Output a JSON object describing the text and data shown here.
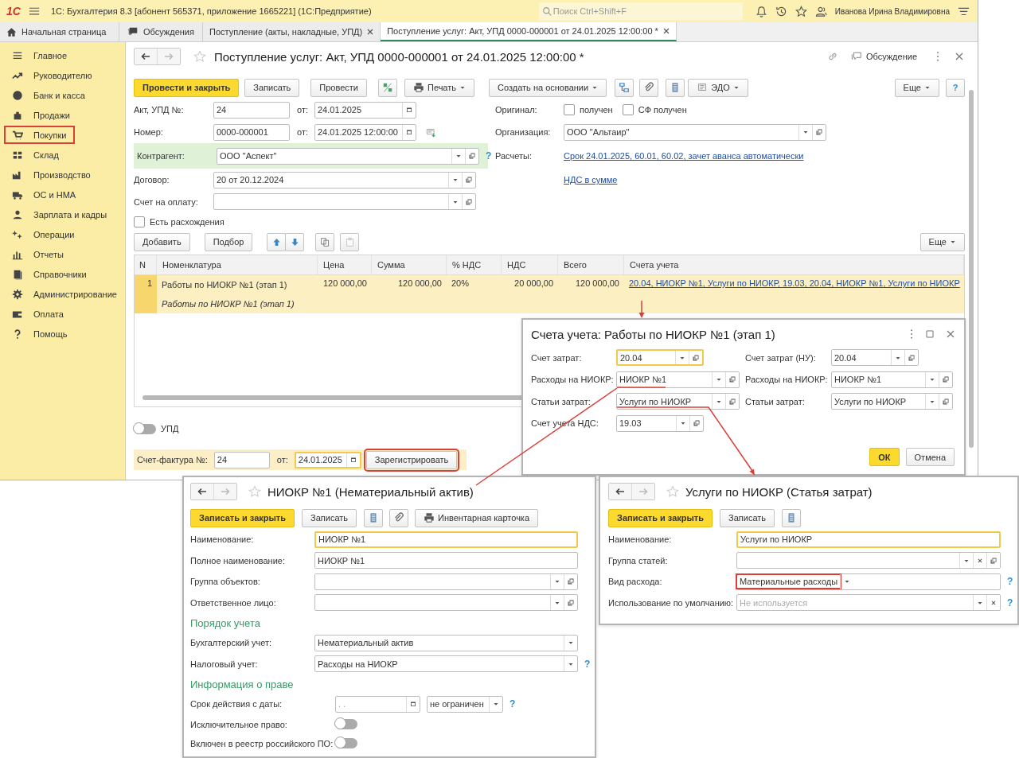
{
  "app": {
    "logo": "1С",
    "title": "1С: Бухгалтерия 8.3 [абонент 565371, приложение 1665221]  (1С:Предприятие)",
    "search_placeholder": "Поиск Ctrl+Shift+F",
    "user": "Иванова Ирина Владимировна"
  },
  "tabs": [
    {
      "label": "Начальная страница",
      "selected": false,
      "closable": false
    },
    {
      "label": "Обсуждения",
      "selected": false,
      "closable": false
    },
    {
      "label": "Поступление (акты, накладные, УПД)",
      "selected": false,
      "closable": true
    },
    {
      "label": "Поступление услуг: Акт, УПД 0000-000001 от 24.01.2025 12:00:00 *",
      "selected": true,
      "closable": true
    }
  ],
  "sidebar": [
    {
      "label": "Главное",
      "highlighted": false
    },
    {
      "label": "Руководителю",
      "highlighted": false
    },
    {
      "label": "Банк и касса",
      "highlighted": false
    },
    {
      "label": "Продажи",
      "highlighted": false
    },
    {
      "label": "Покупки",
      "highlighted": true
    },
    {
      "label": "Склад",
      "highlighted": false
    },
    {
      "label": "Производство",
      "highlighted": false
    },
    {
      "label": "ОС и НМА",
      "highlighted": false
    },
    {
      "label": "Зарплата и кадры",
      "highlighted": false
    },
    {
      "label": "Операции",
      "highlighted": false
    },
    {
      "label": "Отчеты",
      "highlighted": false
    },
    {
      "label": "Справочники",
      "highlighted": false
    },
    {
      "label": "Администрирование",
      "highlighted": false
    },
    {
      "label": "Оплата",
      "highlighted": false
    },
    {
      "label": "Помощь",
      "highlighted": false
    }
  ],
  "document": {
    "title": "Поступление услуг: Акт, УПД 0000-000001 от 24.01.2025 12:00:00 *",
    "discussion": "Обсуждение",
    "toolbar": {
      "post_close": "Провести и закрыть",
      "save": "Записать",
      "post": "Провести",
      "print": "Печать",
      "create_based": "Создать на основании",
      "edo": "ЭДО",
      "more": "Еще",
      "help": "?"
    },
    "act_no": {
      "label": "Акт, УПД №:",
      "value": "24",
      "date_label": "от:",
      "date": "24.01.2025"
    },
    "number": {
      "label": "Номер:",
      "value": "0000-000001",
      "date_label": "от:",
      "date": "24.01.2025 12:00:00"
    },
    "counterparty": {
      "label": "Контрагент:",
      "value": "ООО \"Аспект\"",
      "help": "?"
    },
    "contract": {
      "label": "Договор:",
      "value": "20 от 20.12.2024"
    },
    "payment_invoice": {
      "label": "Счет на оплату:"
    },
    "discrepancies": {
      "label": "Есть расхождения",
      "checked": false
    },
    "original": {
      "label": "Оригинал:",
      "items": [
        {
          "label": "получен",
          "checked": false
        },
        {
          "label": "СФ получен",
          "checked": false
        }
      ]
    },
    "organization": {
      "label": "Организация:",
      "value": "ООО \"Альтаир\""
    },
    "settlements": {
      "label": "Расчеты:",
      "link": "Срок 24.01.2025, 60.01, 60.02, зачет аванса автоматически"
    },
    "vat_link": "НДС в сумме",
    "table_toolbar": {
      "add": "Добавить",
      "pick": "Подбор",
      "more": "Еще",
      "paste_disabled": true
    },
    "table": {
      "columns": [
        "N",
        "Номенклатура",
        "Цена",
        "Сумма",
        "% НДС",
        "НДС",
        "Всего",
        "Счета учета"
      ],
      "rows": [
        {
          "selected": true,
          "n": "1",
          "name": "Работы по НИОКР №1 (этап 1)",
          "content": "Работы по НИОКР №1 (этап 1)",
          "price": "120 000,00",
          "sum": "120 000,00",
          "vat_rate": "20%",
          "vat": "20 000,00",
          "total": "120 000,00",
          "accounts": "20.04, НИОКР №1, Услуги по НИОКР, 19.03, 20.04, НИОКР №1, Услуги по НИОКР"
        }
      ]
    },
    "upd": {
      "label": "УПД",
      "on": false
    },
    "invoice": {
      "label": "Счет-фактура №:",
      "value": "24",
      "date_label": "от:",
      "date": "24.01.2025",
      "date_focused": true,
      "register": "Зарегистрировать",
      "register_highlighted": true
    }
  },
  "accounts_dialog": {
    "title": "Счета учета: Работы по НИОКР №1 (этап 1)",
    "left": [
      {
        "label": "Счет затрат:",
        "value": "20.04",
        "focused": true
      },
      {
        "label": "Расходы на НИОКР:",
        "value": "НИОКР №1",
        "focused": false
      },
      {
        "label": "Статьи затрат:",
        "value": "Услуги по НИОКР",
        "focused": false
      },
      {
        "label": "Счет учета НДС:",
        "value": "19.03",
        "focused": false
      }
    ],
    "right": [
      {
        "label": "Счет затрат (НУ):",
        "value": "20.04"
      },
      {
        "label": "Расходы на НИОКР:",
        "value": "НИОКР №1"
      },
      {
        "label": "Статьи затрат:",
        "value": "Услуги по НИОКР"
      }
    ],
    "ok": "ОК",
    "cancel": "Отмена"
  },
  "niokr_window": {
    "title": "НИОКР №1 (Нематериальный актив)",
    "save_close": "Записать и закрыть",
    "save": "Записать",
    "inventory_card": "Инвентарная карточка",
    "fields": [
      {
        "kind": "text",
        "label": "Наименование:",
        "value": "НИОКР №1",
        "focused": true
      },
      {
        "kind": "text",
        "label": "Полное наименование:",
        "value": "НИОКР №1",
        "focused": false
      },
      {
        "kind": "ref",
        "label": "Группа объектов:"
      },
      {
        "kind": "ref",
        "label": "Ответственное лицо:"
      },
      {
        "kind": "section",
        "label": "Порядок учета"
      },
      {
        "kind": "select",
        "label": "Бухгалтерский учет:",
        "value": "Нематериальный актив"
      },
      {
        "kind": "select",
        "label": "Налоговый учет:",
        "value": "Расходы на НИОКР",
        "help": "?"
      },
      {
        "kind": "section",
        "label": "Информация о праве"
      },
      {
        "kind": "period",
        "label": "Срок действия с даты:",
        "placeholder": ". .",
        "option": "не ограничен",
        "help": "?"
      },
      {
        "kind": "toggle",
        "label": "Исключительное право:",
        "on": false
      },
      {
        "kind": "toggle",
        "label": "Включен в реестр российского ПО:",
        "on": false
      }
    ]
  },
  "expense_window": {
    "title": "Услуги по НИОКР (Статья затрат)",
    "save_close": "Записать и закрыть",
    "save": "Записать",
    "fields": [
      {
        "kind": "text",
        "label": "Наименование:",
        "value": "Услуги по НИОКР",
        "focused": true
      },
      {
        "kind": "ref_clear",
        "label": "Группа статей:"
      },
      {
        "kind": "select",
        "label": "Вид расхода:",
        "value": "Материальные расходы",
        "highlighted": true,
        "help": "?"
      },
      {
        "kind": "select_clear",
        "label": "Использование по умолчанию:",
        "placeholder": "Не используется",
        "help": "?"
      }
    ]
  }
}
